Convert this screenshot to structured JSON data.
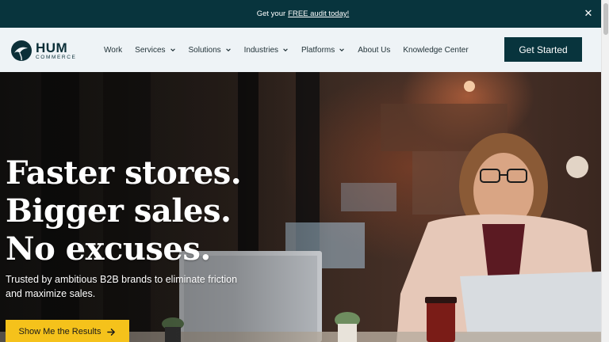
{
  "announcement": {
    "prefix": "Get your",
    "link": "FREE audit today!",
    "close_icon": "close-icon"
  },
  "header": {
    "logo": {
      "main": "HUM",
      "sub": "COMMERCE"
    },
    "nav": [
      {
        "label": "Work",
        "has_dropdown": false
      },
      {
        "label": "Services",
        "has_dropdown": true
      },
      {
        "label": "Solutions",
        "has_dropdown": true
      },
      {
        "label": "Industries",
        "has_dropdown": true
      },
      {
        "label": "Platforms",
        "has_dropdown": true
      },
      {
        "label": "About Us",
        "has_dropdown": false
      },
      {
        "label": "Knowledge Center",
        "has_dropdown": false
      }
    ],
    "cta_label": "Get Started"
  },
  "hero": {
    "headline": [
      "Faster stores.",
      "Bigger sales.",
      "No excuses."
    ],
    "subhead": "Trusted by ambitious B2B brands to eliminate friction and maximize sales.",
    "button_label": "Show Me the Results",
    "button_icon": "arrow-right-icon"
  },
  "colors": {
    "brand_dark": "#08343d",
    "accent_yellow": "#f5c21b",
    "header_bg": "#eef3f6"
  }
}
